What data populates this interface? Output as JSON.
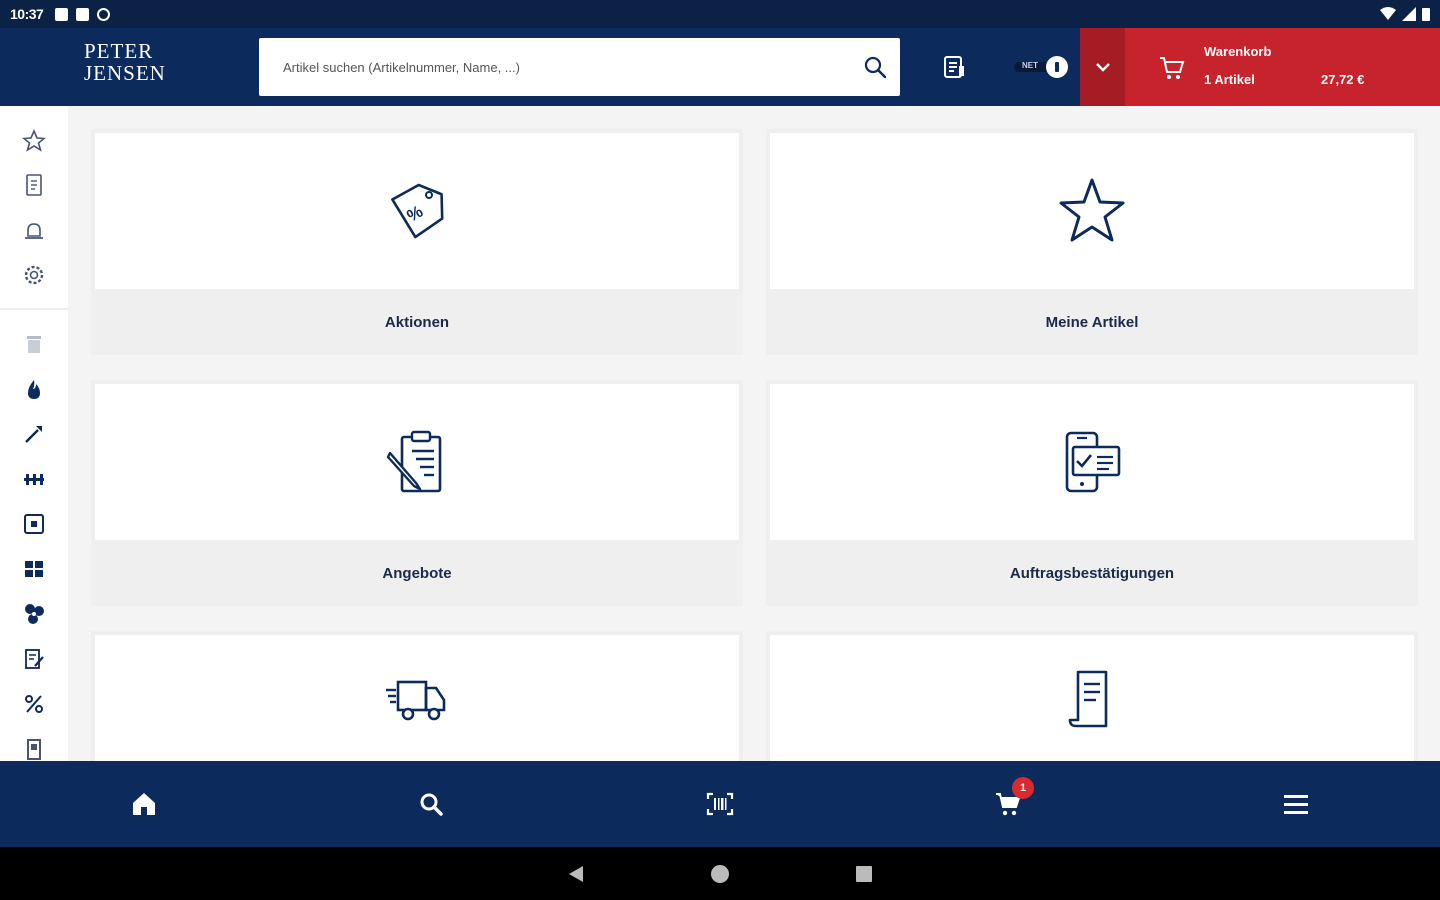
{
  "status_bar": {
    "time": "10:37"
  },
  "header": {
    "logo_line1": "PETER",
    "logo_line2": "JENSEN",
    "search_placeholder": "Artikel suchen (Artikelnummer, Name, ...)",
    "toggle_label": "NET",
    "cart": {
      "title": "Warenkorb",
      "count": "1 Artikel",
      "price": "27,72 €"
    }
  },
  "sidebar": {
    "items": [
      "star-icon",
      "document-icon",
      "bell-icon",
      "gear-icon",
      "trash-icon",
      "flame-icon",
      "wrench-icon",
      "pipe-icon",
      "switch-icon",
      "grid-icon",
      "fan-icon",
      "edit-doc-icon",
      "percent-icon",
      "door-icon"
    ]
  },
  "tiles": [
    {
      "label": "Aktionen",
      "icon": "price-tag-icon"
    },
    {
      "label": "Meine Artikel",
      "icon": "star-icon"
    },
    {
      "label": "Angebote",
      "icon": "clipboard-icon"
    },
    {
      "label": "Auftragsbestätigungen",
      "icon": "order-confirmation-icon"
    },
    {
      "label": "",
      "icon": "delivery-truck-icon"
    },
    {
      "label": "",
      "icon": "receipt-icon"
    }
  ],
  "bottom_nav": {
    "items": [
      "home-icon",
      "search-icon",
      "barcode-scan-icon",
      "cart-icon",
      "menu-icon"
    ],
    "cart_badge": "1"
  },
  "colors": {
    "primary": "#0d2a5c",
    "accent_red": "#c6232c",
    "tile_bg": "#efefef"
  }
}
